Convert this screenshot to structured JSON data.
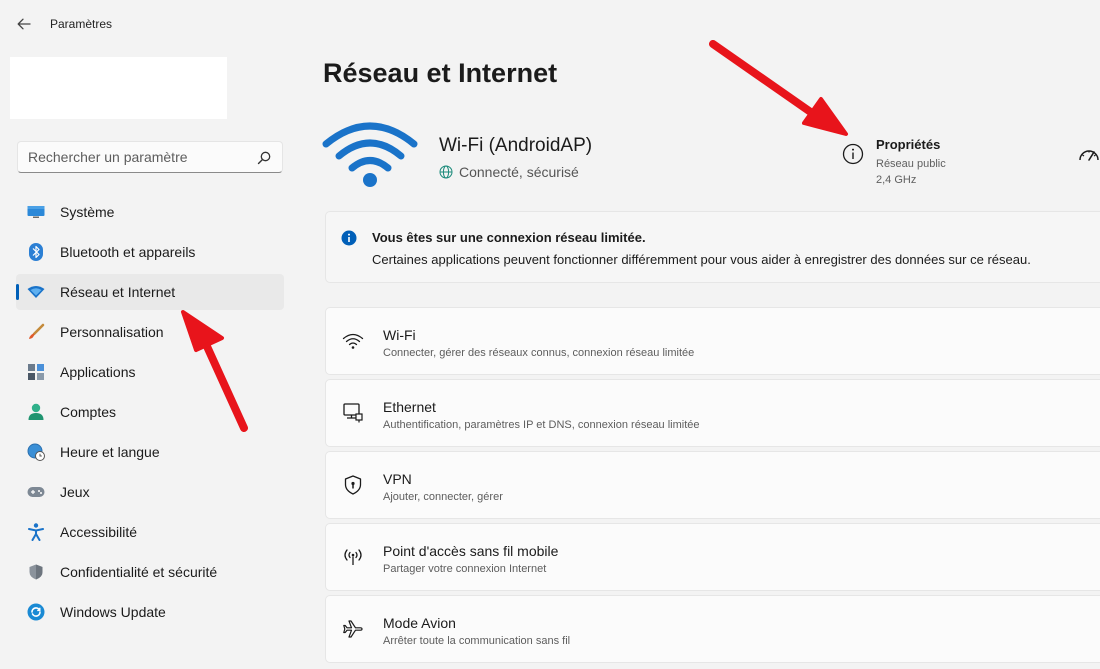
{
  "window": {
    "title": "Paramètres"
  },
  "search": {
    "placeholder": "Rechercher un paramètre"
  },
  "sidebar": {
    "items": [
      {
        "label": "Système",
        "icon": "monitor-icon"
      },
      {
        "label": "Bluetooth et appareils",
        "icon": "bluetooth-icon"
      },
      {
        "label": "Réseau et Internet",
        "icon": "wifi-diamond-icon",
        "active": true
      },
      {
        "label": "Personnalisation",
        "icon": "brush-icon"
      },
      {
        "label": "Applications",
        "icon": "apps-icon"
      },
      {
        "label": "Comptes",
        "icon": "person-icon"
      },
      {
        "label": "Heure et langue",
        "icon": "globe-clock-icon"
      },
      {
        "label": "Jeux",
        "icon": "gamepad-icon"
      },
      {
        "label": "Accessibilité",
        "icon": "accessibility-icon"
      },
      {
        "label": "Confidentialité et sécurité",
        "icon": "shield-icon"
      },
      {
        "label": "Windows Update",
        "icon": "update-icon"
      }
    ]
  },
  "main": {
    "title": "Réseau et Internet",
    "connection": {
      "name": "Wi-Fi (AndroidAP)",
      "status": "Connecté, sécurisé"
    },
    "properties": {
      "title": "Propriétés",
      "network_type": "Réseau public",
      "band": "2,4 GHz"
    },
    "info": {
      "title": "Vous êtes sur une connexion réseau limitée.",
      "text": "Certaines applications peuvent fonctionner différemment pour vous aider à enregistrer des données sur ce réseau."
    },
    "cards": [
      {
        "title": "Wi-Fi",
        "subtitle": "Connecter, gérer des réseaux connus, connexion réseau limitée",
        "icon": "wifi-icon"
      },
      {
        "title": "Ethernet",
        "subtitle": "Authentification, paramètres IP et DNS, connexion réseau limitée",
        "icon": "ethernet-icon"
      },
      {
        "title": "VPN",
        "subtitle": "Ajouter, connecter, gérer",
        "icon": "vpn-shield-icon"
      },
      {
        "title": "Point d'accès sans fil mobile",
        "subtitle": "Partager votre connexion Internet",
        "icon": "hotspot-icon"
      },
      {
        "title": "Mode Avion",
        "subtitle": "Arrêter toute la communication sans fil",
        "icon": "airplane-icon"
      }
    ]
  },
  "colors": {
    "accent": "#005fb8",
    "wifi_blue": "#1a73c9",
    "annotation_arrow": "#e8141b",
    "background": "#f3f3f3"
  }
}
